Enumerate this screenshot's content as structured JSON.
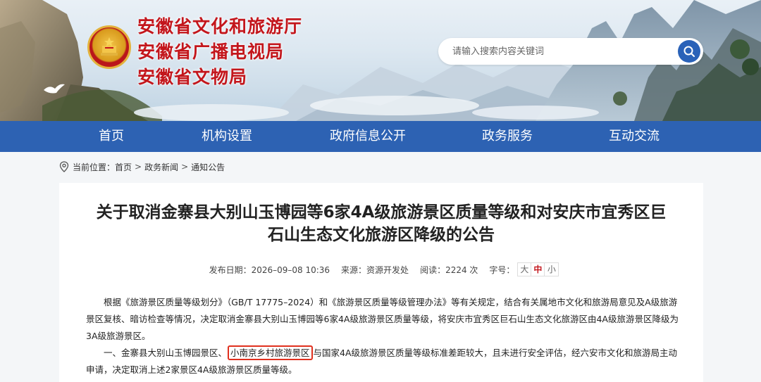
{
  "header": {
    "titles": [
      "安徽省文化和旅游厅",
      "安徽省广播电视局",
      "安徽省文物局"
    ],
    "search_placeholder": "请输入搜索内容关键词",
    "search_icon": "search-icon"
  },
  "nav": {
    "items": [
      "首页",
      "机构设置",
      "政府信息公开",
      "政务服务",
      "互动交流"
    ]
  },
  "breadcrumb": {
    "label": "当前位置：",
    "items": [
      "首页",
      "政务新闻",
      "通知公告"
    ],
    "separator": ">"
  },
  "article": {
    "title_line1": "关于取消金寨县大别山玉博园等6家4A级旅游景区质量等级和对安庆市宜秀区巨",
    "title_line2": "石山生态文化旅游区降级的公告",
    "meta": {
      "date": "发布日期：2026–09–08 10:36",
      "source": "来源：资源开发处",
      "views": "阅读：2224 次",
      "font_label": "字号：",
      "font_sizes": [
        "大",
        "中",
        "小"
      ],
      "active_size": "中"
    },
    "para1": "根据《旅游景区质量等级划分》（GB/T 17775–2024）和《旅游景区质量等级管理办法》等有关规定，结合有关属地市文化和旅游局意见及A级旅游景区复核、暗访检查等情况，决定取消金寨县大别山玉博园等6家4A级旅游景区质量等级，将安庆市宜秀区巨石山生态文化旅游区由4A级旅游景区降级为3A级旅游景区。",
    "para2_before": "一、金寨县大别山玉博园景区、",
    "para2_highlight": "小南京乡村旅游景区",
    "para2_after": "与国家4A级旅游景区质量等级标准差距较大，且未进行安全评估，经六安市文化和旅游局主动申请，决定取消上述2家景区4A级旅游景区质量等级。"
  },
  "colors": {
    "nav_bg": "#2d62b3",
    "title_red": "#c3161c",
    "highlight_border": "#e0301e"
  }
}
